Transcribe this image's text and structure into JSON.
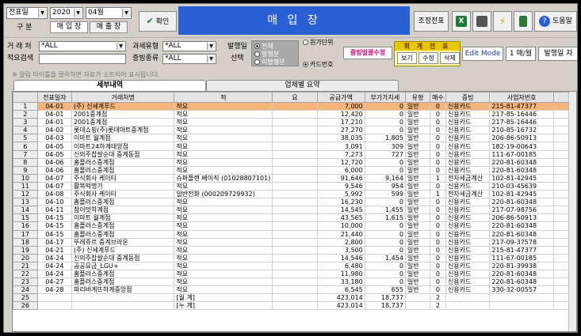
{
  "toolbar": {
    "type_select": "전표일",
    "year_select": "2020",
    "month_select": "04월",
    "label_gubun": "구  분",
    "label_sale": "매 입 장",
    "label_purchase": "매 출 장",
    "confirm_label": "확인",
    "title": "매 입 장",
    "adjust_label": "조정전표",
    "help_label": "도움말"
  },
  "filters": {
    "trader_label": "거 래 처",
    "trader_value": "*ALL",
    "memo_label": "적요검색",
    "memo_value": "",
    "tax_type_label": "과세유형",
    "tax_type_value": "*ALL",
    "evidence_label": "증빙종류",
    "evidence_value": "*ALL",
    "issue_label": "발행일",
    "select_label": "선택",
    "radio_all": "전체",
    "radio_issued": "발행분",
    "radio_unissued": "미발행분",
    "radio_unit": "원가단위",
    "radio_card": "카드번호",
    "bulk_label": "증빙일괄수정",
    "group_title": "회 계 전 표",
    "view_label": "보기",
    "edit_label": "수정",
    "delete_label": "삭제",
    "edit_mode": "Edit Mode",
    "page_label": "1 매/월",
    "issue_btn": "발행일 자"
  },
  "hint": "※ 알림 타이틀을 클릭하면 자료가 소트되어 표시됩니다.",
  "tabs": [
    {
      "label": "세부내역"
    },
    {
      "label": "업체별 요약"
    }
  ],
  "table": {
    "headers": [
      "",
      "전표일자",
      "거래처명",
      "적",
      "요",
      "공급가액",
      "부가가치세",
      "유형",
      "매수",
      "증빙",
      "사업자번호",
      ""
    ],
    "rows": [
      [
        "1",
        "04-01",
        "(주) 신세계푸드",
        "적요",
        "",
        "7,000",
        "0",
        "일반",
        "0",
        "신용카드",
        "215-81-47377"
      ],
      [
        "2",
        "04-01",
        "2001중계점",
        "적요",
        "",
        "12,420",
        "0",
        "일반",
        "0",
        "신용카드",
        "217-85-16446"
      ],
      [
        "3",
        "04-01",
        "2001중계점",
        "적요",
        "",
        "17,210",
        "0",
        "일반",
        "0",
        "신용카드",
        "217-85-16446"
      ],
      [
        "4",
        "04-02",
        "롯데쇼핑(주)롯데마트중계점",
        "적요",
        "",
        "27,270",
        "0",
        "일반",
        "0",
        "신용카드",
        "210-85-16732"
      ],
      [
        "5",
        "04-03",
        "이마트 월계점",
        "적요",
        "",
        "38,035",
        "1,805",
        "일반",
        "0",
        "신용카드",
        "206-86-50913"
      ],
      [
        "6",
        "04-05",
        "이마트24하계태양점",
        "적요",
        "",
        "3,091",
        "309",
        "일반",
        "0",
        "신용카드",
        "182-19-00643"
      ],
      [
        "7",
        "04-05",
        "신의주찹쌀순대 중계동점",
        "적요",
        "",
        "7,273",
        "727",
        "일반",
        "0",
        "신용카드",
        "111-67-00185"
      ],
      [
        "8",
        "04-06",
        "홈플러스중계점",
        "적요",
        "",
        "12,720",
        "0",
        "일반",
        "0",
        "신용카드",
        "220-81-60348"
      ],
      [
        "9",
        "04-06",
        "홈플러스중계점",
        "적요",
        "",
        "6,000",
        "0",
        "일반",
        "0",
        "신용카드",
        "220-81-60348"
      ],
      [
        "10",
        "04-07",
        "주식회사 케이티",
        "슈퍼플랜 베이직 (01028807101)",
        "",
        "91,646",
        "9,164",
        "일반",
        "1",
        "전자세금계산",
        "102-81-42945"
      ],
      [
        "11",
        "04-07",
        "활복떡명가",
        "적요",
        "",
        "9,546",
        "954",
        "일반",
        "0",
        "신용카드",
        "210-03-45639"
      ],
      [
        "12",
        "04-08",
        "주식회사 케이티",
        "일반전화 (000209729932)",
        "",
        "5,992",
        "599",
        "일반",
        "1",
        "전자세금계산",
        "102-81-42945"
      ],
      [
        "13",
        "04-10",
        "홈플러스중계점",
        "적요",
        "",
        "16,230",
        "0",
        "일반",
        "0",
        "신용카드",
        "220-81-60348"
      ],
      [
        "14",
        "04-11",
        "참이맛하계점",
        "적요",
        "",
        "14,545",
        "1,455",
        "일반",
        "0",
        "신용카드",
        "217-07-98756"
      ],
      [
        "15",
        "04-15",
        "이마트 월계점",
        "적요",
        "",
        "43,565",
        "1,615",
        "일반",
        "0",
        "신용카드",
        "206-86-50913"
      ],
      [
        "16",
        "04-15",
        "홈플러스중계점",
        "적요",
        "",
        "10,000",
        "0",
        "일반",
        "0",
        "신용카드",
        "220-81-60348"
      ],
      [
        "17",
        "04-15",
        "홈플러스중계점",
        "적요",
        "",
        "21,440",
        "0",
        "일반",
        "0",
        "신용카드",
        "220-81-60348"
      ],
      [
        "18",
        "04-17",
        "뚜레쥬르 중계브라운",
        "적요",
        "",
        "2,800",
        "0",
        "일반",
        "0",
        "신용카드",
        "217-09-37578"
      ],
      [
        "19",
        "04-21",
        "(주) 신세계푸드",
        "적요",
        "",
        "3,500",
        "0",
        "일반",
        "0",
        "신용카드",
        "215-81-47377"
      ],
      [
        "20",
        "04-24",
        "신의주찹쌀순대 중계동점",
        "적요",
        "",
        "14,546",
        "1,454",
        "일반",
        "0",
        "신용카드",
        "111-67-00185"
      ],
      [
        "21",
        "04-24",
        "공공요금_LGU+",
        "적요",
        "",
        "6,480",
        "0",
        "일반",
        "0",
        "신용카드",
        "220-81-39938"
      ],
      [
        "22",
        "04-24",
        "홈플러스중계점",
        "적요",
        "",
        "11,980",
        "0",
        "일반",
        "0",
        "신용카드",
        "220-81-60348"
      ],
      [
        "23",
        "04-27",
        "홈플러스중계점",
        "적요",
        "",
        "33,180",
        "0",
        "일반",
        "0",
        "신용카드",
        "220-81-60348"
      ],
      [
        "24",
        "04-28",
        "파리바게뜨하계중앙점",
        "적요",
        "",
        "6,545",
        "655",
        "일반",
        "0",
        "신용카드",
        "330-32-00557"
      ],
      [
        "25",
        "",
        "",
        "[월      계]",
        "",
        "423,014",
        "18,737",
        "",
        "2",
        "",
        ""
      ],
      [
        "26",
        "",
        "",
        "[누      계]",
        "",
        "423,014",
        "18,737",
        "",
        "2",
        "",
        ""
      ]
    ]
  },
  "colors": {
    "title_bg": "#2a5fd6",
    "highlight_row": "#f4b47a",
    "group_bg": "#e8c800",
    "magenta": "#d0007a"
  }
}
